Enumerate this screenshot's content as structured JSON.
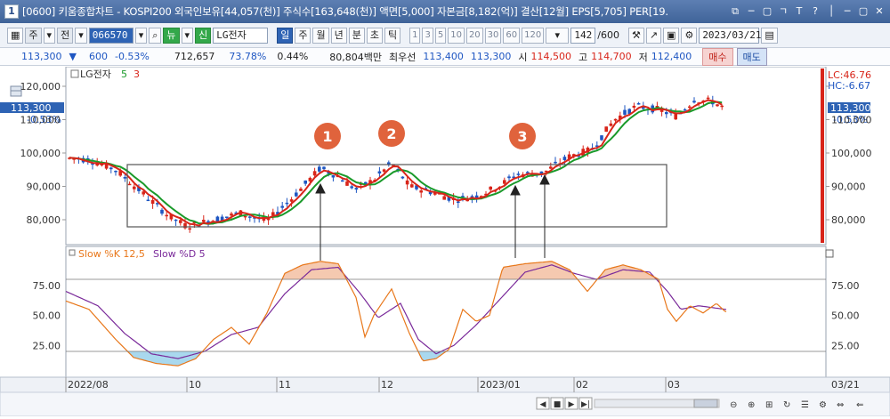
{
  "window": {
    "number": "1",
    "title": "[0600] 키움종합차트 - KOSPI200 외국인보유[44,057(천)] 주식수[163,648(천)] 액면[5,000] 자본금[8,182(억)] 결산[12월] EPS[5,705] PER[19.",
    "controls": [
      "⧉",
      "─",
      "▢",
      "ㄱ",
      "T",
      "?",
      "│",
      "─",
      "▢",
      "✕"
    ]
  },
  "toolbar": {
    "period": "주",
    "field": "전",
    "code": "066570",
    "new_label": "뉴",
    "credit_label": "신",
    "name": "LG전자",
    "intervals": [
      "일",
      "주",
      "월",
      "년",
      "분",
      "초",
      "틱"
    ],
    "minutes": [
      "1",
      "3",
      "5",
      "10",
      "20",
      "30",
      "60",
      "120"
    ],
    "count": "142",
    "total": "/600",
    "date": "2023/03/21"
  },
  "quote": {
    "price": "113,300",
    "arrow": "▼",
    "change": "600",
    "change_pct": "-0.53%",
    "volume": "712,657",
    "ratio1": "73.78%",
    "ratio2": "0.44%",
    "amount": "80,804백만",
    "pref_label": "최우선",
    "pref_sell": "113,400",
    "pref_buy": "113,300",
    "open_label": "시",
    "open": "114,500",
    "high_label": "고",
    "high": "114,700",
    "low_label": "저",
    "low": "112,400",
    "buy_label": "매수",
    "sell_label": "매도"
  },
  "price_panel": {
    "legend_name": "LG전자",
    "legend_ma1": "5",
    "legend_ma2": "3",
    "lc_label": "LC:46.76",
    "hc_label": "HC:-6.67",
    "cur_price": "113,300",
    "cur_pct": "-0.53%",
    "y_ticks": [
      "120,000",
      "110,000",
      "100,000",
      "90,000",
      "80,000"
    ],
    "markers": [
      "1",
      "2",
      "3"
    ]
  },
  "stoch_panel": {
    "legend_k": "Slow %K 12,5",
    "legend_d": "Slow %D 5",
    "y_ticks": [
      "75.00",
      "50.00",
      "25.00"
    ]
  },
  "x_axis": {
    "labels": [
      "2022/08",
      "10",
      "11",
      "12",
      "2023/01",
      "02",
      "03"
    ],
    "right_label": "03/21"
  },
  "colors": {
    "up": "#d8251a",
    "down": "#1e56c2",
    "ma_short": "#d8251a",
    "ma_long": "#1a9a2a",
    "marker": "#e0633c",
    "stoch_k": "#e8771a",
    "stoch_d": "#7a2a9a"
  }
}
